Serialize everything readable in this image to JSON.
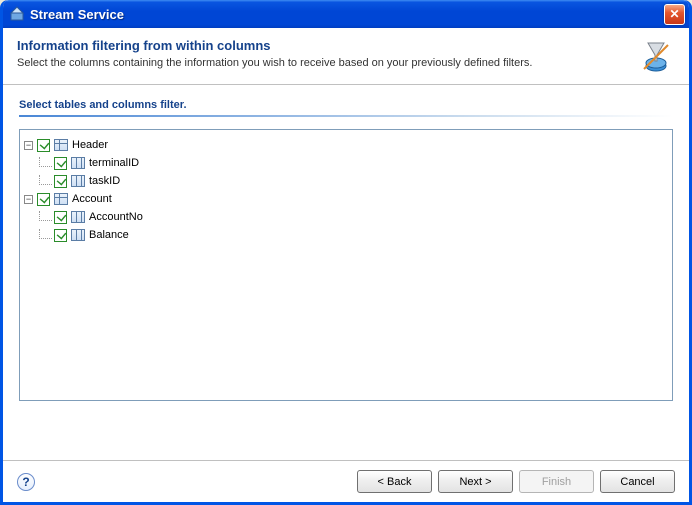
{
  "window": {
    "title": "Stream Service"
  },
  "header": {
    "title": "Information filtering from within columns",
    "subtitle": "Select the columns containing the information you wish to receive based on your previously defined filters."
  },
  "section": {
    "label": "Select tables and columns filter."
  },
  "tree": [
    {
      "name": "Header",
      "checked": true,
      "expanded": true,
      "icon": "table",
      "children": [
        {
          "name": "terminalID",
          "checked": true,
          "icon": "column"
        },
        {
          "name": "taskID",
          "checked": true,
          "icon": "column"
        }
      ]
    },
    {
      "name": "Account",
      "checked": true,
      "expanded": true,
      "icon": "table",
      "children": [
        {
          "name": "AccountNo",
          "checked": true,
          "icon": "column"
        },
        {
          "name": "Balance",
          "checked": true,
          "icon": "column"
        }
      ]
    }
  ],
  "buttons": {
    "back": "< Back",
    "next": "Next >",
    "finish": "Finish",
    "cancel": "Cancel"
  },
  "expander_glyph": "−",
  "help_glyph": "?",
  "close_glyph": "✕"
}
